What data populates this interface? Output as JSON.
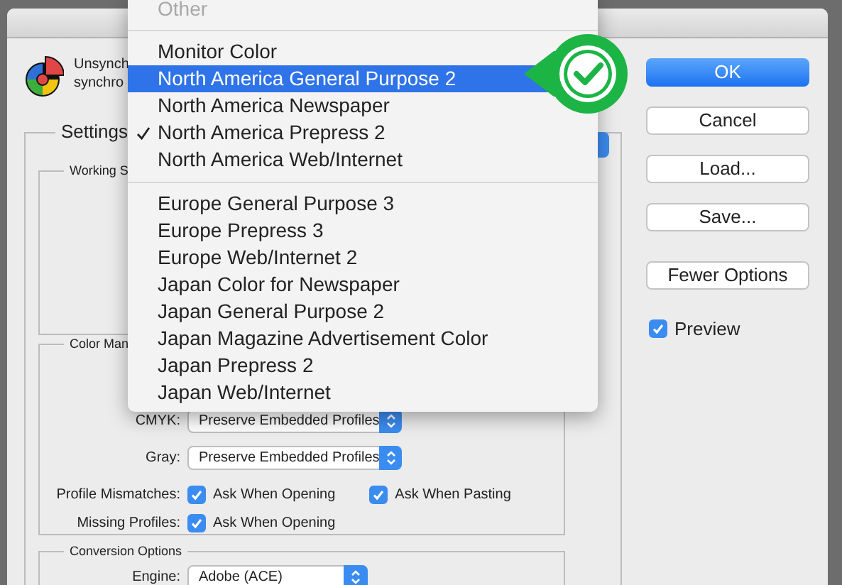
{
  "header": {
    "lines": [
      "Unsynch",
      "synchro"
    ]
  },
  "settings": {
    "title": "Settings"
  },
  "working_spaces": {
    "title": "Working S"
  },
  "color_management": {
    "title": "Color Man",
    "rows": [
      {
        "kind": "select",
        "label": "CMYK:",
        "value": "Preserve Embedded Profiles"
      },
      {
        "kind": "select",
        "label": "Gray:",
        "value": "Preserve Embedded Profiles"
      },
      {
        "kind": "checks",
        "label": "Profile Mismatches:",
        "options": [
          {
            "label": "Ask When Opening",
            "checked": true
          },
          {
            "label": "Ask When Pasting",
            "checked": true
          }
        ]
      },
      {
        "kind": "checks",
        "label": "Missing Profiles:",
        "options": [
          {
            "label": "Ask When Opening",
            "checked": true
          }
        ]
      }
    ]
  },
  "conversion": {
    "title": "Conversion Options",
    "rows": [
      {
        "kind": "select",
        "label": "Engine:",
        "value": "Adobe (ACE)"
      }
    ]
  },
  "buttons": [
    {
      "label": "OK",
      "default": true
    },
    {
      "label": "Cancel",
      "default": false
    },
    {
      "label": "Load...",
      "default": false
    },
    {
      "label": "Save...",
      "default": false
    },
    {
      "label": "Fewer Options",
      "default": false
    }
  ],
  "preview": {
    "label": "Preview",
    "checked": true
  },
  "menu": {
    "items": [
      {
        "kind": "item",
        "label": "Other",
        "disabled": true,
        "selected": false,
        "checked": false
      },
      {
        "kind": "separator"
      },
      {
        "kind": "item",
        "label": "Monitor Color",
        "disabled": false,
        "selected": false,
        "checked": false
      },
      {
        "kind": "item",
        "label": "North America General Purpose 2",
        "disabled": false,
        "selected": true,
        "checked": false
      },
      {
        "kind": "item",
        "label": "North America Newspaper",
        "disabled": false,
        "selected": false,
        "checked": false
      },
      {
        "kind": "item",
        "label": "North America Prepress 2",
        "disabled": false,
        "selected": false,
        "checked": true
      },
      {
        "kind": "item",
        "label": "North America Web/Internet",
        "disabled": false,
        "selected": false,
        "checked": false
      },
      {
        "kind": "separator"
      },
      {
        "kind": "item",
        "label": "Europe General Purpose 3",
        "disabled": false,
        "selected": false,
        "checked": false
      },
      {
        "kind": "item",
        "label": "Europe Prepress 3",
        "disabled": false,
        "selected": false,
        "checked": false
      },
      {
        "kind": "item",
        "label": "Europe Web/Internet 2",
        "disabled": false,
        "selected": false,
        "checked": false
      },
      {
        "kind": "item",
        "label": "Japan Color for Newspaper",
        "disabled": false,
        "selected": false,
        "checked": false
      },
      {
        "kind": "item",
        "label": "Japan General Purpose 2",
        "disabled": false,
        "selected": false,
        "checked": false
      },
      {
        "kind": "item",
        "label": "Japan Magazine Advertisement Color",
        "disabled": false,
        "selected": false,
        "checked": false
      },
      {
        "kind": "item",
        "label": "Japan Prepress 2",
        "disabled": false,
        "selected": false,
        "checked": false
      },
      {
        "kind": "item",
        "label": "Japan Web/Internet",
        "disabled": false,
        "selected": false,
        "checked": false
      }
    ]
  }
}
